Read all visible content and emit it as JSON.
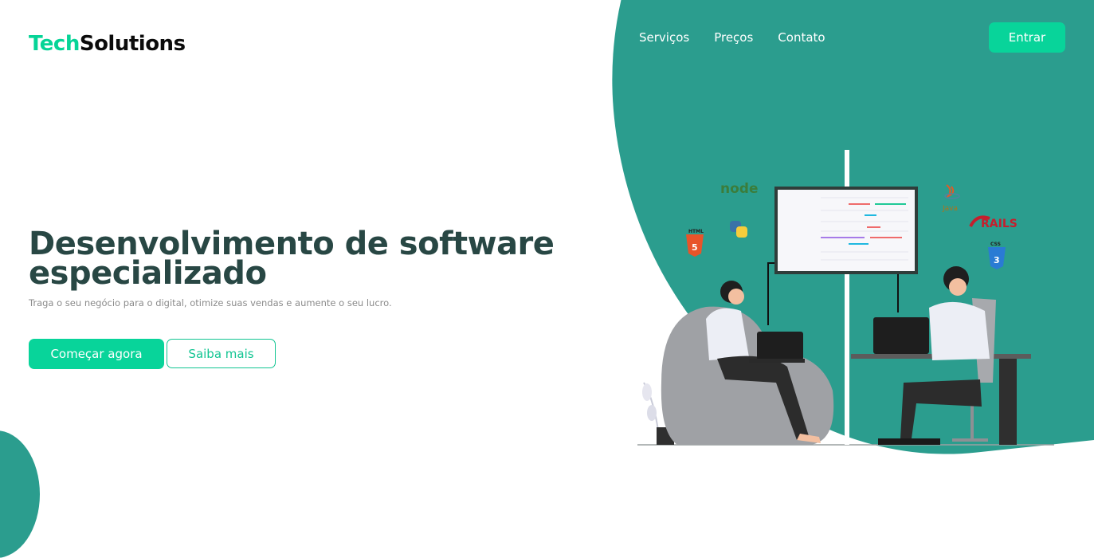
{
  "brand": {
    "part1": "Tech",
    "part2": "Solutions",
    "accent": "#06d497"
  },
  "nav": {
    "items": [
      "Serviços",
      "Preços",
      "Contato"
    ]
  },
  "header": {
    "login_label": "Entrar"
  },
  "hero": {
    "title": "Desenvolvimento de software especializado",
    "subtitle": "Traga o seu negócio para o digital, otimize suas vendas e aumente o seu lucro.",
    "primary_label": "Começar agora",
    "secondary_label": "Saiba mais"
  },
  "illustration": {
    "icons": [
      "node-icon",
      "python-icon",
      "html5-icon",
      "java-icon",
      "rails-icon",
      "css3-icon"
    ],
    "rails_text": "RAILS",
    "html_text": "HTML",
    "css_text": "CSS",
    "java_text": "Java"
  },
  "colors": {
    "teal": "#2b9d8e",
    "green": "#08d49a",
    "heading": "#284744"
  }
}
